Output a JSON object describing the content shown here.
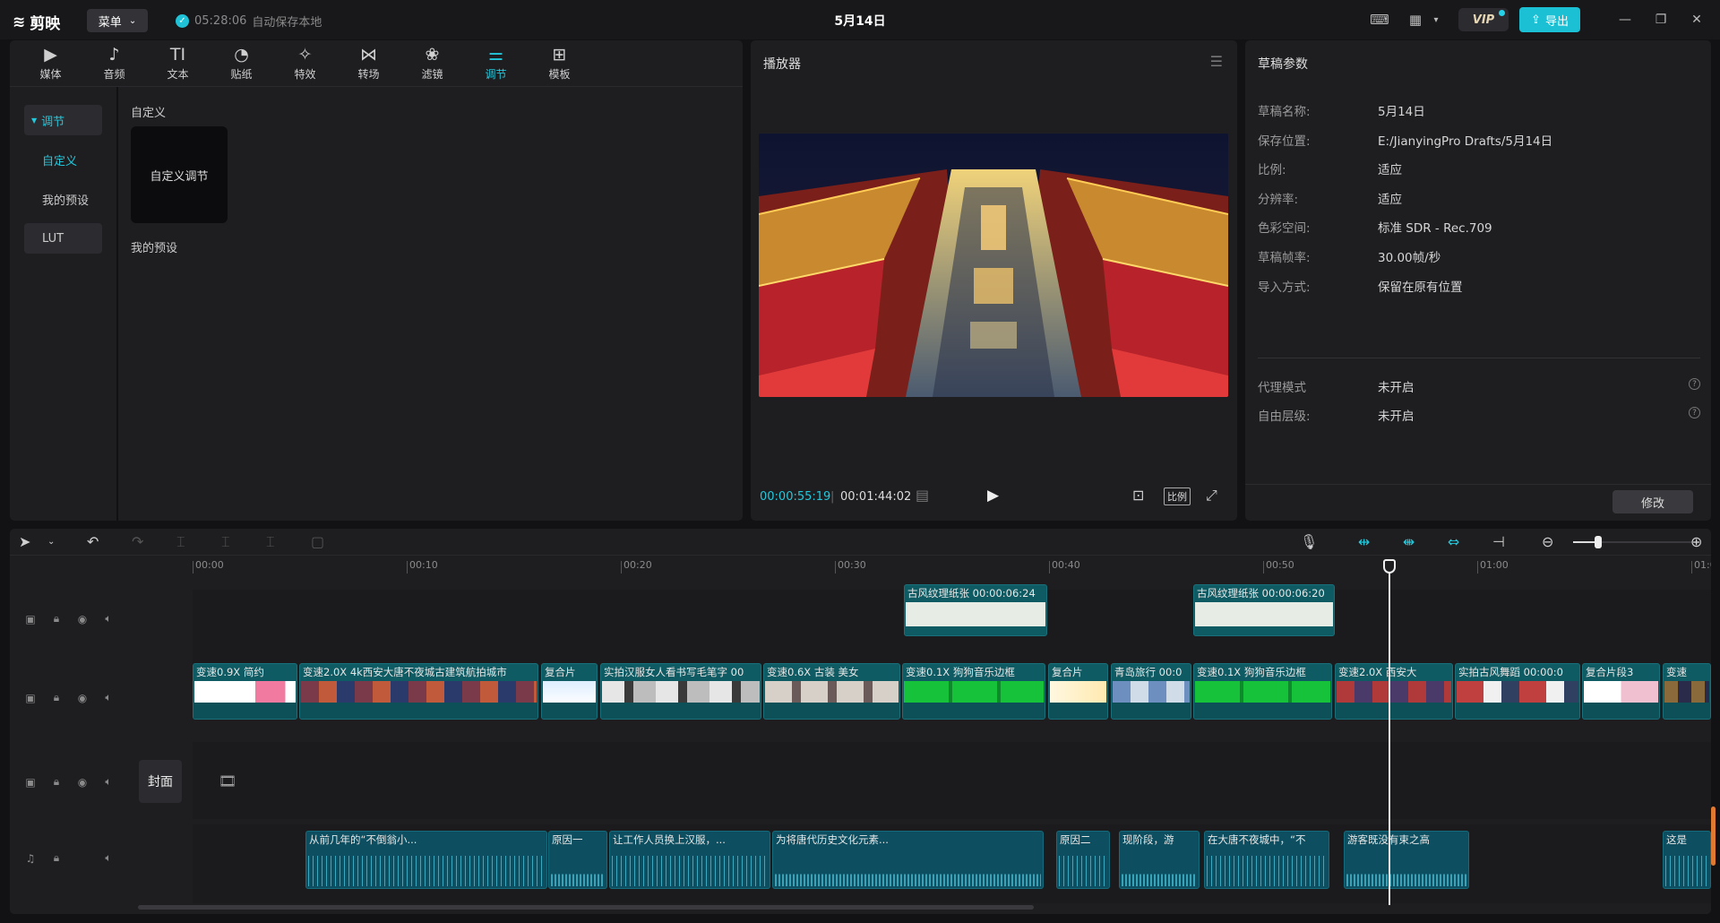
{
  "app": {
    "logo": "剪映",
    "menu_label": "菜单",
    "save_time": "05:28:06",
    "save_text": "自动保存本地",
    "title": "5月14日",
    "vip_label": "VIP",
    "export_label": "导出"
  },
  "toolbar": {
    "tools": [
      {
        "label": "媒体",
        "icon": "media-icon"
      },
      {
        "label": "音频",
        "icon": "audio-icon"
      },
      {
        "label": "文本",
        "icon": "text-icon"
      },
      {
        "label": "贴纸",
        "icon": "sticker-icon"
      },
      {
        "label": "特效",
        "icon": "effects-icon"
      },
      {
        "label": "转场",
        "icon": "transition-icon"
      },
      {
        "label": "滤镜",
        "icon": "filter-icon"
      },
      {
        "label": "调节",
        "icon": "adjust-icon"
      },
      {
        "label": "模板",
        "icon": "template-icon"
      }
    ],
    "active": "调节"
  },
  "adjust_panel": {
    "side_header": "调节",
    "side_items": [
      "自定义",
      "我的预设",
      "LUT"
    ],
    "section_custom": "自定义",
    "card_label": "自定义调节",
    "section_presets": "我的预设"
  },
  "player": {
    "title": "播放器",
    "current_time": "00:00:55:19",
    "total_time": "00:01:44:02",
    "ratio_label": "比例"
  },
  "props": {
    "title": "草稿参数",
    "rows": [
      {
        "key": "草稿名称:",
        "value": "5月14日"
      },
      {
        "key": "保存位置:",
        "value": "E:/JianyingPro Drafts/5月14日"
      },
      {
        "key": "比例:",
        "value": "适应"
      },
      {
        "key": "分辨率:",
        "value": "适应"
      },
      {
        "key": "色彩空间:",
        "value": "标准 SDR - Rec.709"
      },
      {
        "key": "草稿帧率:",
        "value": "30.00帧/秒"
      },
      {
        "key": "导入方式:",
        "value": "保留在原有位置"
      }
    ],
    "rows2": [
      {
        "key": "代理模式",
        "value": "未开启"
      },
      {
        "key": "自由层级:",
        "value": "未开启"
      }
    ],
    "modify_label": "修改"
  },
  "timeline": {
    "ruler": [
      "00:00",
      "00:10",
      "00:20",
      "00:30",
      "00:40",
      "00:50",
      "01:00",
      "01:0"
    ],
    "cover_label": "封面",
    "texture_clips": [
      "古风纹理纸张  00:00:06:24",
      "古风纹理纸张  00:00:06:20"
    ],
    "video_clips": [
      "变速0.9X  简约",
      "变速2.0X  4k西安大唐不夜城古建筑航拍城市",
      "复合片",
      "实拍汉服女人看书写毛笔字  00",
      "变速0.6X  古装 美女",
      "变速0.1X  狗狗音乐边框",
      "复合片",
      "青岛旅行  00:0",
      "变速0.1X  狗狗音乐边框",
      "变速2.0X  西安大",
      "实拍古风舞蹈  00:00:0",
      "复合片段3",
      "变速"
    ],
    "audio_clips": [
      "从前几年的“不倒翁小...",
      "原因一",
      "让工作人员换上汉服，...",
      "为将唐代历史文化元素...",
      "原因二",
      "现阶段，游",
      "在大唐不夜城中，“不",
      "游客既没有束之高",
      "这是"
    ]
  },
  "colors": {
    "accent": "#22c8dc",
    "clip": "#0f5b63",
    "bg": "#121214",
    "panel": "#1e1e21"
  }
}
